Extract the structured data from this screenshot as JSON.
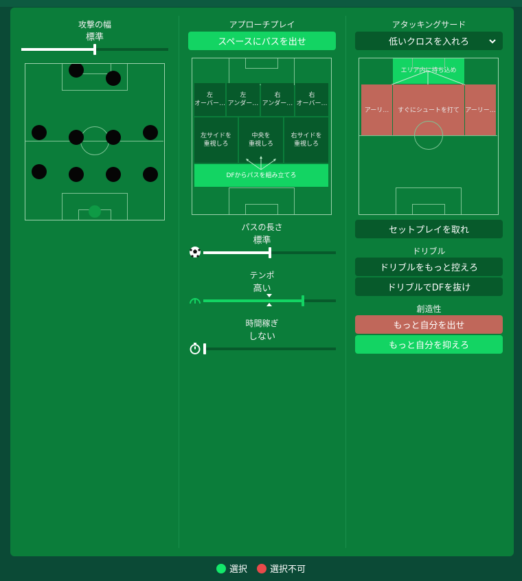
{
  "colors": {
    "selected": "#13d463",
    "unavailable": "#e84a4a",
    "panel": "#0b7d3a",
    "dark_button": "#075a2b"
  },
  "width": {
    "title": "攻撃の幅",
    "value": "標準",
    "level": 0.5
  },
  "approach": {
    "title": "アプローチプレイ",
    "selected_button": "スペースにパスを出せ",
    "zones": {
      "left_overlap": "左\nオーバー…",
      "left_underlap": "左\nアンダー…",
      "right_underlap": "右\nアンダー…",
      "right_overlap": "右\nオーバー…",
      "left_side": "左サイドを\n重視しろ",
      "center": "中央を\n重視しろ",
      "right_side": "右サイドを\n重視しろ",
      "build_from_back": "DFからパスを組み立てろ"
    }
  },
  "pass_length": {
    "title": "パスの長さ",
    "value": "標準",
    "level": 0.5,
    "icon": "soccer-ball-icon"
  },
  "tempo": {
    "title": "テンポ",
    "value": "高い",
    "level": 0.75,
    "marker": 0.5,
    "icon": "speedometer-icon"
  },
  "time_wasting": {
    "title": "時間稼ぎ",
    "value": "しない",
    "level": 0.0,
    "icon": "stopwatch-icon"
  },
  "final_third": {
    "title": "アタッキングサード",
    "dropdown": "低いクロスを入れろ",
    "zones": {
      "work_into_box": "エリア内に持ち込め",
      "early_left": "アーリ…",
      "shoot_on_sight": "すぐにシュートを打て",
      "early_right": "アーリー…"
    },
    "set_pieces": "セットプレイを取れ"
  },
  "dribbling": {
    "title": "ドリブル",
    "less": "ドリブルをもっと控えろ",
    "more": "ドリブルでDFを抜け"
  },
  "creativity": {
    "title": "創造性",
    "express": "もっと自分を出せ",
    "discipline": "もっと自分を抑えろ"
  },
  "legend": {
    "selected": "選択",
    "unavailable": "選択不可"
  }
}
